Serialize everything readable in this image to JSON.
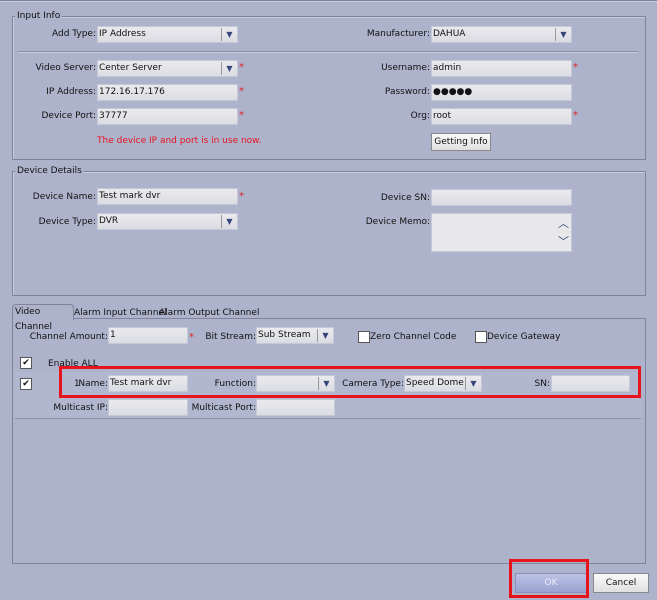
{
  "input_info": {
    "title": "Input Info",
    "add_type": {
      "label": "Add Type:",
      "value": "IP Address"
    },
    "manufacturer": {
      "label": "Manufacturer:",
      "value": "DAHUA"
    },
    "video_server": {
      "label": "Video Server:",
      "value": "Center Server"
    },
    "ip_address": {
      "label": "IP Address:",
      "value": "172.16.17.176"
    },
    "device_port": {
      "label": "Device Port:",
      "value": "37777"
    },
    "username": {
      "label": "Username:",
      "value": "admin"
    },
    "password": {
      "label": "Password:",
      "value": "●●●●●"
    },
    "org": {
      "label": "Org:",
      "value": "root"
    },
    "error": "The device IP and port is in use now.",
    "getting_info": "Getting Info",
    "required_mark": "*"
  },
  "device_details": {
    "title": "Device Details",
    "device_name": {
      "label": "Device Name:",
      "value": "Test mark dvr"
    },
    "device_type": {
      "label": "Device Type:",
      "value": "DVR"
    },
    "device_sn": {
      "label": "Device SN:",
      "value": ""
    },
    "device_memo": {
      "label": "Device Memo:",
      "value": ""
    }
  },
  "tabs": [
    {
      "label": "Video Channel",
      "active": true
    },
    {
      "label": "Alarm Input Channel"
    },
    {
      "label": "Alarm Output Channel"
    }
  ],
  "video_channel": {
    "channel_amount": {
      "label": "Channel Amount:",
      "value": "1"
    },
    "bit_stream": {
      "label": "Bit Stream:",
      "value": "Sub Stream"
    },
    "zero_channel_code": {
      "label": "Zero Channel Code",
      "checked": false
    },
    "device_gateway": {
      "label": "Device Gateway",
      "checked": false
    },
    "enable_all": {
      "label": "Enable ALL",
      "checked": true
    },
    "channel": {
      "number": "1",
      "name_label": "Name:",
      "name": "Test mark dvr",
      "function_label": "Function:",
      "function": "",
      "camera_type_label": "Camera Type:",
      "camera_type": "Speed Dome",
      "sn_label": "SN:",
      "sn": "",
      "checked": true,
      "multicast_ip_label": "Multicast IP:",
      "multicast_ip": "",
      "multicast_port_label": "Multicast Port:",
      "multicast_port": ""
    }
  },
  "footer": {
    "ok": "OK",
    "cancel": "Cancel"
  },
  "colors": {
    "background": "#adb3cb",
    "highlight": "#e8141c",
    "error": "#e8141c"
  }
}
